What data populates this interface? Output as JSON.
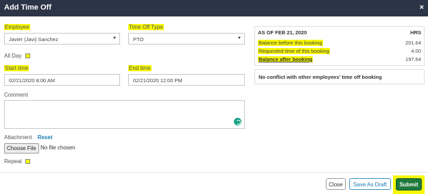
{
  "dialog": {
    "title": "Add Time Off",
    "close_glyph": "×"
  },
  "form": {
    "employee": {
      "label": "Employee",
      "value": "Javier (Javi) Sanchez"
    },
    "time_off_type": {
      "label": "Time Off Type",
      "value": "PTO"
    },
    "all_day": {
      "label": "All Day"
    },
    "start_time": {
      "label": "Start time",
      "value": "02/21/2020 8:00 AM"
    },
    "end_time": {
      "label": "End time",
      "value": "02/21/2020 12:00 PM"
    },
    "comment": {
      "label": "Comment",
      "value": ""
    },
    "attachment": {
      "label": "Attachment",
      "reset_label": "Reset",
      "choose_file_label": "Choose File",
      "no_file_text": "No file chosen"
    },
    "repeat": {
      "label": "Repeat"
    }
  },
  "balance": {
    "as_of": "AS OF FEB 21, 2020",
    "unit": "HRS",
    "rows": [
      {
        "label": "Balance before this booking",
        "value": "201.64"
      },
      {
        "label": "Requested time of this booking",
        "value": "4.00"
      },
      {
        "label": "Balance after booking",
        "value": "197.64"
      }
    ]
  },
  "conflict": {
    "text": "No conflict with other employees' time off booking"
  },
  "footer": {
    "close_label": "Close",
    "draft_label": "Save As Draft",
    "submit_label": "Submit"
  },
  "colors": {
    "highlight": "#f7f707",
    "titlebar": "#2c3447",
    "submit": "#1e7a3c",
    "link": "#1c7ab8"
  }
}
